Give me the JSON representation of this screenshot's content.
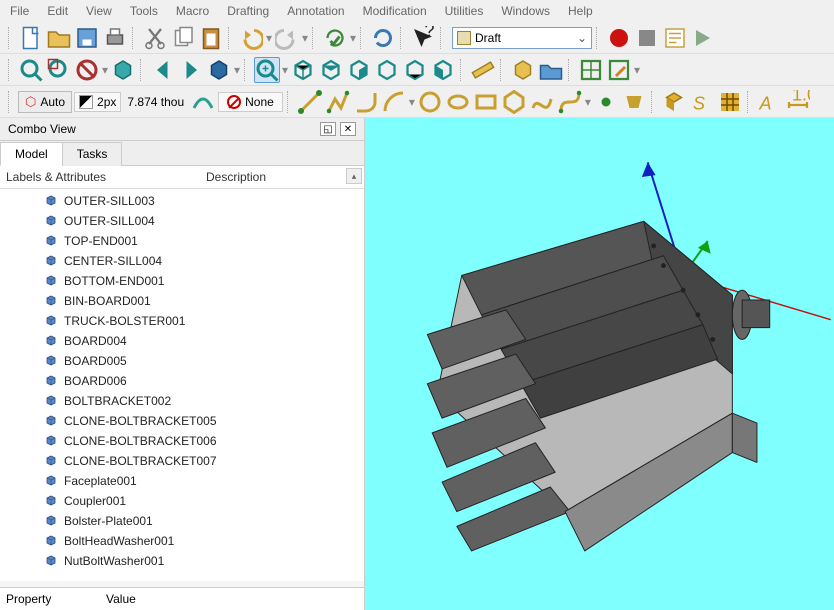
{
  "menu": [
    "File",
    "Edit",
    "View",
    "Tools",
    "Macro",
    "Drafting",
    "Annotation",
    "Modification",
    "Utilities",
    "Windows",
    "Help"
  ],
  "workbench": {
    "label": "Draft"
  },
  "status": {
    "auto": "Auto",
    "px": "2px",
    "thou": "7.874 thou",
    "none": "None"
  },
  "combo": {
    "title": "Combo View",
    "tabs": {
      "model": "Model",
      "tasks": "Tasks"
    },
    "headers": {
      "labels": "Labels & Attributes",
      "desc": "Description"
    },
    "items": [
      "OUTER-SILL003",
      "OUTER-SILL004",
      "TOP-END001",
      "CENTER-SILL004",
      "BOTTOM-END001",
      "BIN-BOARD001",
      "TRUCK-BOLSTER001",
      "BOARD004",
      "BOARD005",
      "BOARD006",
      "BOLTBRACKET002",
      "CLONE-BOLTBRACKET005",
      "CLONE-BOLTBRACKET006",
      "CLONE-BOLTBRACKET007",
      "Faceplate001",
      "Coupler001",
      "Bolster-Plate001",
      "BoltHeadWasher001",
      "NutBoltWasher001"
    ],
    "prop": {
      "property": "Property",
      "value": "Value"
    }
  }
}
